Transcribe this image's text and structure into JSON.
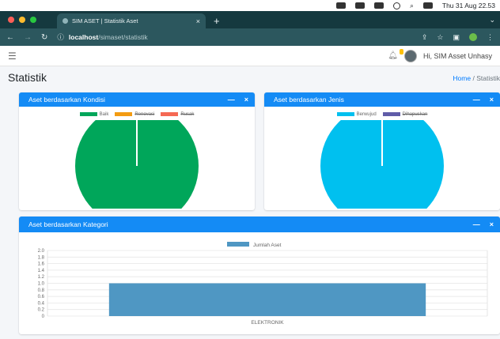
{
  "os_bar": {
    "clock": "Thu 31 Aug  22.53"
  },
  "browser": {
    "tab_title": "SIM ASET | Statistik Aset",
    "url_host": "localhost",
    "url_path": "/simaset/statistik"
  },
  "navbar": {
    "user_greeting": "Hi, SIM Asset Unhasy"
  },
  "page": {
    "title": "Statistik",
    "breadcrumb_home": "Home",
    "breadcrumb_sep": "/",
    "breadcrumb_current": "Statistik"
  },
  "colors": {
    "primary": "#148bf5",
    "kondisi_baik": "#00a65a",
    "kondisi_renovasi": "#f39c12",
    "kondisi_rusak": "#f56954",
    "jenis_berwujud": "#00c0ef",
    "jenis_dihapuskan": "#605ca8",
    "bar": "#4f97c3"
  },
  "card_kondisi": {
    "title": "Aset berdasarkan Kondisi",
    "legend": [
      "Baik",
      "Renovasi",
      "Rusak"
    ]
  },
  "card_jenis": {
    "title": "Aset berdasarkan Jenis",
    "legend": [
      "Berwujud",
      "Dihapuskan"
    ]
  },
  "card_kategori": {
    "title": "Aset berdasarkan Kategori",
    "legend": [
      "Jumlah Aset"
    ]
  },
  "card_tools": {
    "minimize": "—",
    "close": "×"
  },
  "chart_data": [
    {
      "type": "pie",
      "labels": [
        "Baik",
        "Renovasi",
        "Rusak"
      ],
      "values": [
        1,
        0,
        0
      ],
      "hidden_in_legend": [
        "Renovasi",
        "Rusak"
      ],
      "legend_position": "top"
    },
    {
      "type": "pie",
      "labels": [
        "Berwujud",
        "Dihapuskan"
      ],
      "values": [
        1,
        0
      ],
      "hidden_in_legend": [
        "Dihapuskan"
      ],
      "legend_position": "top"
    },
    {
      "type": "bar",
      "categories": [
        "ELEKTRONIK"
      ],
      "series": [
        {
          "name": "Jumlah Aset",
          "values": [
            1
          ]
        }
      ],
      "ylim": [
        0,
        2
      ],
      "yticks": [
        "0",
        "0.2",
        "0.4",
        "0.6",
        "0.8",
        "1.0",
        "1.2",
        "1.4",
        "1.6",
        "1.8",
        "2.0"
      ],
      "grid": true,
      "legend_position": "top"
    }
  ]
}
